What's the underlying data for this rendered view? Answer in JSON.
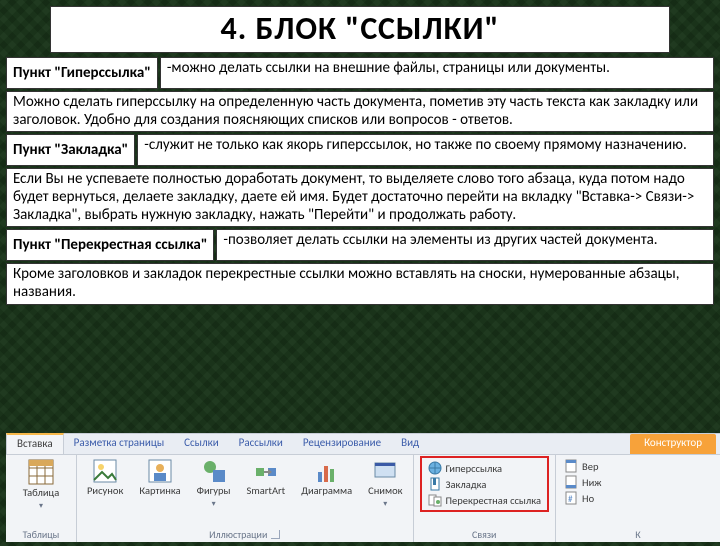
{
  "title": "4. БЛОК \"ССЫЛКИ\"",
  "items": [
    {
      "label": "Пункт \"Гиперссылка\"",
      "desc": "-можно делать ссылки на внешние файлы, страницы или документы.",
      "after": "Можно сделать гиперссылку на определенную часть документа, пометив эту часть текста как закладку или заголовок. Удобно для создания поясняющих списков или вопросов - ответов."
    },
    {
      "label": "Пункт \"Закладка\"",
      "desc": "-служит не только как якорь гиперссылок, но также по своему прямому назначению.",
      "after": "Если Вы не успеваете полностью доработать документ, то выделяете слово того абзаца, куда потом надо будет вернуться, делаете закладку, даете ей имя. Будет достаточно перейти на вкладку \"Вставка-> Связи-> Закладка\", выбрать нужную закладку, нажать \"Перейти\" и продолжать работу."
    },
    {
      "label": "Пункт \"Перекрестная ссылка\"",
      "desc": "-позволяет делать ссылки на элементы из других частей документа.",
      "after": "Кроме заголовков и закладок перекрестные ссылки можно вставлять на сноски, нумерованные абзацы, названия."
    }
  ],
  "ribbon": {
    "tabs": [
      "Вставка",
      "Разметка страницы",
      "Ссылки",
      "Рассылки",
      "Рецензирование",
      "Вид",
      "Конструктор"
    ],
    "active_tab_index": 0,
    "groups": {
      "tables": {
        "btn": "Таблица",
        "label": "Таблицы"
      },
      "illus": {
        "btns": [
          "Рисунок",
          "Картинка",
          "Фигуры",
          "SmartArt",
          "Диаграмма",
          "Снимок"
        ],
        "label": "Иллюстрации"
      },
      "links": {
        "items": [
          "Гиперссылка",
          "Закладка",
          "Перекрестная ссылка"
        ],
        "label": "Связи"
      },
      "header": {
        "items": [
          "Вер",
          "Ниж",
          "Но"
        ],
        "label": "К"
      }
    }
  }
}
